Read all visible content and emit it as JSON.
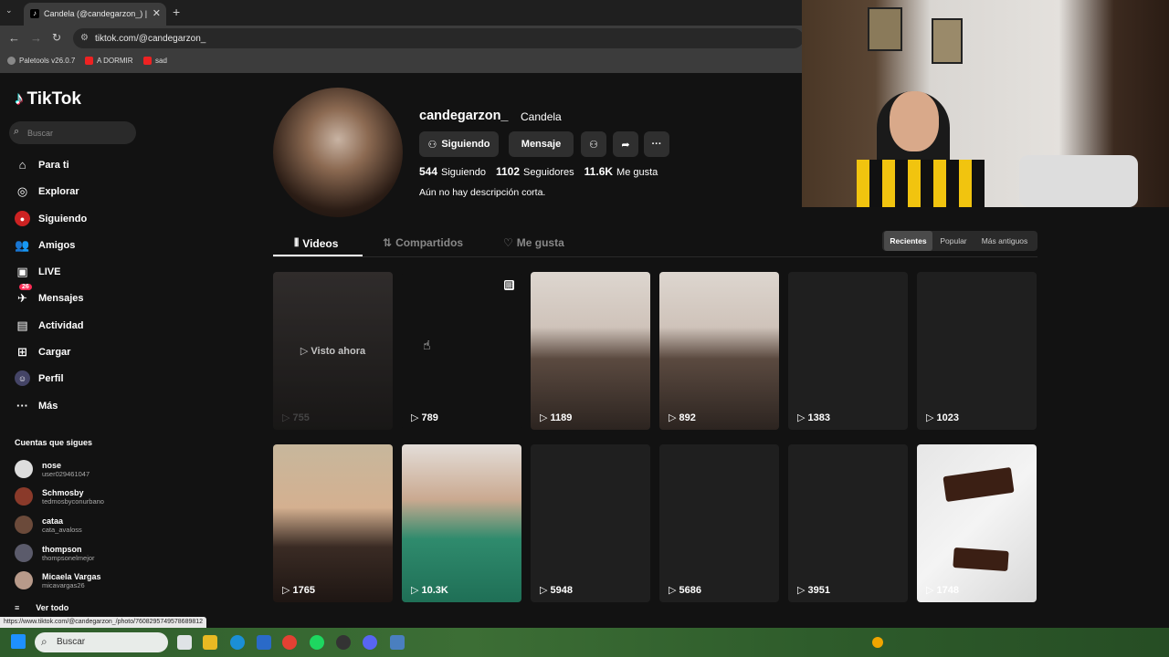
{
  "browser": {
    "tab_title": "Candela (@candegarzon_) |",
    "url": "tiktok.com/@candegarzon_",
    "bookmarks": [
      "Paletools v26.0.7",
      "A DORMIR",
      "sad"
    ],
    "status_url": "https://www.tiktok.com/@candegarzon_/photo/7608295749578689812"
  },
  "sidebar": {
    "logo": "TikTok",
    "search_placeholder": "Buscar",
    "nav": [
      {
        "label": "Para ti",
        "icon": "home-icon"
      },
      {
        "label": "Explorar",
        "icon": "compass-icon"
      },
      {
        "label": "Siguiendo",
        "icon": "following-icon"
      },
      {
        "label": "Amigos",
        "icon": "friends-icon"
      },
      {
        "label": "LIVE",
        "icon": "live-icon"
      },
      {
        "label": "Mensajes",
        "icon": "messages-icon",
        "badge": "26"
      },
      {
        "label": "Actividad",
        "icon": "activity-icon"
      },
      {
        "label": "Cargar",
        "icon": "upload-icon"
      },
      {
        "label": "Perfil",
        "icon": "profile-icon"
      },
      {
        "label": "Más",
        "icon": "more-icon"
      }
    ],
    "following_title": "Cuentas que sigues",
    "accounts": [
      {
        "name": "nose",
        "user": "user029461047"
      },
      {
        "name": "Schmosby",
        "user": "tedmosbyconurbano"
      },
      {
        "name": "cataa",
        "user": "cata_avaloss"
      },
      {
        "name": "thompson",
        "user": "thompsonelmejor"
      },
      {
        "name": "Micaela Vargas",
        "user": "micavargas26"
      }
    ],
    "see_all": "Ver todo"
  },
  "profile": {
    "username": "candegarzon_",
    "display_name": "Candela",
    "btn_following": "Siguiendo",
    "btn_message": "Mensaje",
    "following_count": "544",
    "following_label": "Siguiendo",
    "followers_count": "1102",
    "followers_label": "Seguidores",
    "likes_count": "11.6K",
    "likes_label": "Me gusta",
    "bio": "Aún no hay descripción corta."
  },
  "tabs": {
    "videos": "Videos",
    "shared": "Compartidos",
    "liked": "Me gusta"
  },
  "sort": [
    "Recientes",
    "Popular",
    "Más antiguos"
  ],
  "videos": [
    {
      "views": "755",
      "overlay": "Visto ahora"
    },
    {
      "views": "789"
    },
    {
      "views": "1189"
    },
    {
      "views": "892"
    },
    {
      "views": "1383"
    },
    {
      "views": "1023"
    },
    {
      "views": "1765"
    },
    {
      "views": "10.3K"
    },
    {
      "views": "5948"
    },
    {
      "views": "5686"
    },
    {
      "views": "3951"
    },
    {
      "views": "1748"
    }
  ],
  "taskbar": {
    "search_placeholder": "Buscar"
  }
}
